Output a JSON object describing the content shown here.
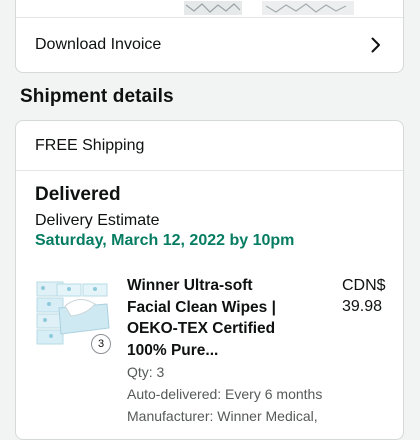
{
  "invoice": {
    "label": "Download Invoice"
  },
  "shipment": {
    "section_title": "Shipment details",
    "shipping_label": "FREE Shipping",
    "status": "Delivered",
    "estimate_label": "Delivery Estimate",
    "estimate_date": "Saturday, March 12, 2022 by 10pm"
  },
  "item": {
    "title_lines": [
      "Winner Ultra-soft",
      "Facial Clean Wipes |",
      "OEKO-TEX Certified",
      "100% Pure..."
    ],
    "price_currency": "CDN$",
    "price_value": "39.98",
    "qty": "Qty: 3",
    "auto_delivered": "Auto-delivered: Every 6 months",
    "manufacturer": "Manufacturer: Winner Medical,",
    "badge_count": "3"
  },
  "icons": {
    "chevron": "chevron-right-icon",
    "product": "tissue-box-image"
  },
  "colors": {
    "accent_green": "#067d62",
    "text": "#0f1111",
    "muted": "#565959",
    "border": "#d5d9d9"
  }
}
